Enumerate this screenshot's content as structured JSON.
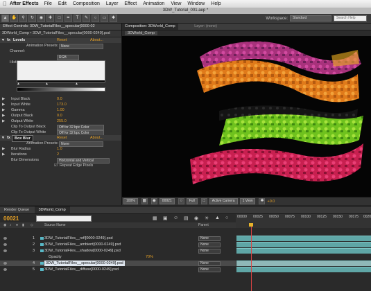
{
  "menubar": {
    "apple": "",
    "app": "After Effects",
    "items": [
      "File",
      "Edit",
      "Composition",
      "Layer",
      "Effect",
      "Animation",
      "View",
      "Window",
      "Help"
    ]
  },
  "window_title": "3DW_Tutorial_001.aep *",
  "workspace": {
    "label": "Workspace:",
    "value": "Standard",
    "search_placeholder": "Search Help"
  },
  "effect_controls": {
    "tab": "Effect Controls: 3DW_TutorialFiles__specular[0000-02",
    "subtitle": "3DWorld_Comp • 3DW_TutorialFiles__specular[0000-0249].psd",
    "levels": {
      "name": "Levels",
      "reset": "Reset",
      "about": "About...",
      "presets_label": "Animation Presets:",
      "presets_value": "None",
      "channel_label": "Channel:",
      "channel_value": "RGB",
      "histogram_label": "Histogram",
      "props": [
        {
          "label": "Input Black",
          "value": "0.0"
        },
        {
          "label": "Input White",
          "value": "173.0"
        },
        {
          "label": "Gamma",
          "value": "1.00"
        },
        {
          "label": "Output Black",
          "value": "0.0"
        },
        {
          "label": "Output White",
          "value": "255.0"
        }
      ],
      "clip_black_label": "Clip To Output Black",
      "clip_black_value": "Off for 32 bpc Color",
      "clip_white_label": "Clip To Output White",
      "clip_white_value": "Off for 32 bpc Color"
    },
    "box_blur": {
      "name": "Box Blur",
      "reset": "Reset",
      "about": "About...",
      "presets_label": "Animation Presets:",
      "presets_value": "None",
      "radius_label": "Blur Radius",
      "radius_value": "1.0",
      "iter_label": "Iterations",
      "iter_value": "2",
      "dim_label": "Blur Dimensions",
      "dim_value": "Horizontal and Vertical",
      "repeat_label": "Repeat Edge Pixels"
    }
  },
  "composition": {
    "tab": "Composition: 3DWorld_Comp",
    "layer_tab": "Layer: (none)",
    "subtab": "3DWorld_Comp",
    "zoom": "100%",
    "timecode": "00021",
    "resolution": "Full",
    "camera": "Active Camera",
    "view": "1 View",
    "exposure": "+0.0"
  },
  "timeline": {
    "tabs": [
      "Render Queue",
      "3DWorld_Comp"
    ],
    "timecode": "00021",
    "search_placeholder": "",
    "header": {
      "source": "Source Name",
      "parent": "Parent"
    },
    "ruler": [
      "00000",
      "00025",
      "00050",
      "00075",
      "00100",
      "00125",
      "00150",
      "00175",
      "00200"
    ],
    "layers": [
      {
        "num": "1",
        "name": "3DW_TutorialFiles__refl[0000-0249].psd",
        "parent": "None"
      },
      {
        "num": "2",
        "name": "3DW_TutorialFiles__ambient[0000-0249].psd",
        "parent": "None"
      },
      {
        "num": "3",
        "name": "3DW_TutorialFiles__shadow[0000-0249].psd",
        "parent": "None"
      },
      {
        "num": "4",
        "name": "3DW_TutorialFiles__specular[0000-0249].psd",
        "parent": "None"
      },
      {
        "num": "5",
        "name": "3DW_TutorialFiles__diffuse[0000-0249].psd",
        "parent": "None"
      }
    ],
    "opacity_label": "Opacity",
    "opacity_value": "70%"
  }
}
